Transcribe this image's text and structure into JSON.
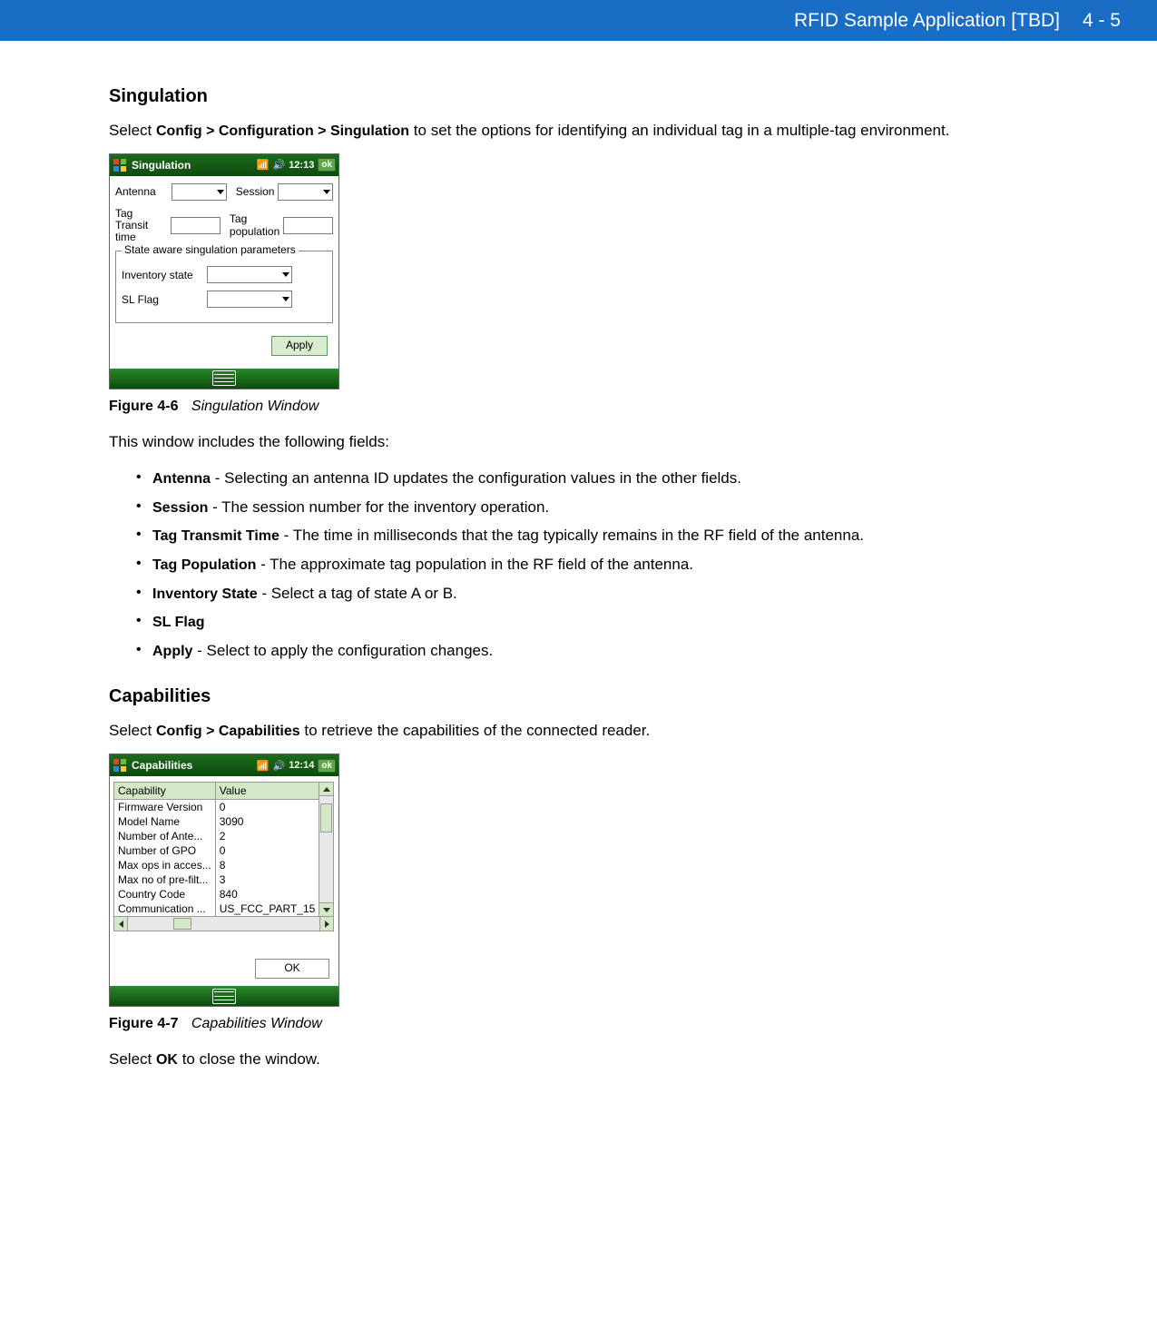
{
  "header": {
    "title": "RFID Sample Application [TBD]",
    "page": "4 - 5"
  },
  "section1": {
    "heading": "Singulation",
    "intro_prefix": "Select ",
    "intro_bold": "Config > Configuration > Singulation",
    "intro_suffix": " to set the options for identifying an individual tag in a multiple-tag environment.",
    "fields_intro": "This window includes the following fields:",
    "figure_num": "Figure 4-6",
    "figure_title": "Singulation Window",
    "bullets": [
      {
        "bold": "Antenna",
        "text": " - Selecting an antenna ID updates the configuration values in the other fields."
      },
      {
        "bold": "Session",
        "text": " - The session number for the inventory operation."
      },
      {
        "bold": "Tag Transmit Time",
        "text": " - The time in milliseconds that the tag typically remains in the RF field of the antenna."
      },
      {
        "bold": "Tag Population",
        "text": " - The approximate tag population in the RF field of the antenna."
      },
      {
        "bold": "Inventory State",
        "text": " - Select a tag of state A or B."
      },
      {
        "bold": "SL Flag",
        "text": ""
      },
      {
        "bold": "Apply",
        "text": " - Select to apply the configuration changes."
      }
    ]
  },
  "singulation_device": {
    "title": "Singulation",
    "time": "12:13",
    "ok": "ok",
    "labels": {
      "antenna": "Antenna",
      "session": "Session",
      "tag_transit": "Tag\nTransit time",
      "tag_pop": "Tag\npopulation",
      "fieldset": "State aware singulation parameters",
      "inv_state": "Inventory state",
      "sl_flag": "SL Flag",
      "apply": "Apply"
    }
  },
  "section2": {
    "heading": "Capabilities",
    "intro_prefix": "Select ",
    "intro_bold": "Config > Capabilities",
    "intro_suffix": " to retrieve the capabilities of the connected reader.",
    "figure_num": "Figure 4-7",
    "figure_title": "Capabilities Window",
    "outro_prefix": "Select ",
    "outro_bold": "OK",
    "outro_suffix": " to close the window."
  },
  "capabilities_device": {
    "title": "Capabilities",
    "time": "12:14",
    "ok": "ok",
    "headers": {
      "cap": "Capability",
      "val": "Value"
    },
    "rows": [
      {
        "cap": "Firmware Version",
        "val": "0"
      },
      {
        "cap": "Model Name",
        "val": "3090"
      },
      {
        "cap": "Number of Ante...",
        "val": "2"
      },
      {
        "cap": "Number of GPO",
        "val": "0"
      },
      {
        "cap": "Max ops in acces...",
        "val": "8"
      },
      {
        "cap": "Max no of pre-filt...",
        "val": "3"
      },
      {
        "cap": "Country Code",
        "val": "840"
      },
      {
        "cap": "Communication ...",
        "val": "US_FCC_PART_15"
      }
    ],
    "ok_btn": "OK"
  }
}
